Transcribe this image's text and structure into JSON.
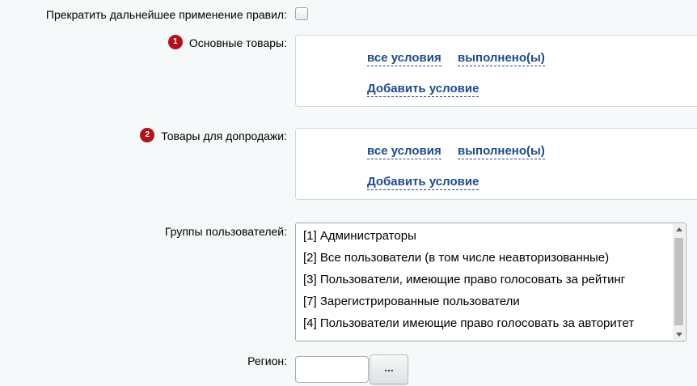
{
  "stop_rules": {
    "label": "Прекратить дальнейшее применение правил:",
    "checked": false
  },
  "main_goods": {
    "badge": "1",
    "label": "Основные товары:",
    "condition_all": "все условия",
    "condition_done": "выполнено(ы)",
    "add_condition": "Добавить условие"
  },
  "upsell_goods": {
    "badge": "2",
    "label": "Товары для допродажи:",
    "condition_all": "все условия",
    "condition_done": "выполнено(ы)",
    "add_condition": "Добавить условие"
  },
  "user_groups": {
    "label": "Группы пользователей:",
    "options": [
      "[1] Администраторы",
      "[2] Все пользователи (в том числе неавторизованные)",
      "[3] Пользователи, имеющие право голосовать за рейтинг",
      "[7] Зарегистрированные пользователи",
      "[4] Пользователи имеющие право голосовать за авторитет"
    ]
  },
  "region": {
    "label": "Регион:",
    "value": "",
    "button_label": "..."
  },
  "colors": {
    "background": "#f5f9f9",
    "link": "#1d4b8c",
    "badge": "#b3121b"
  }
}
